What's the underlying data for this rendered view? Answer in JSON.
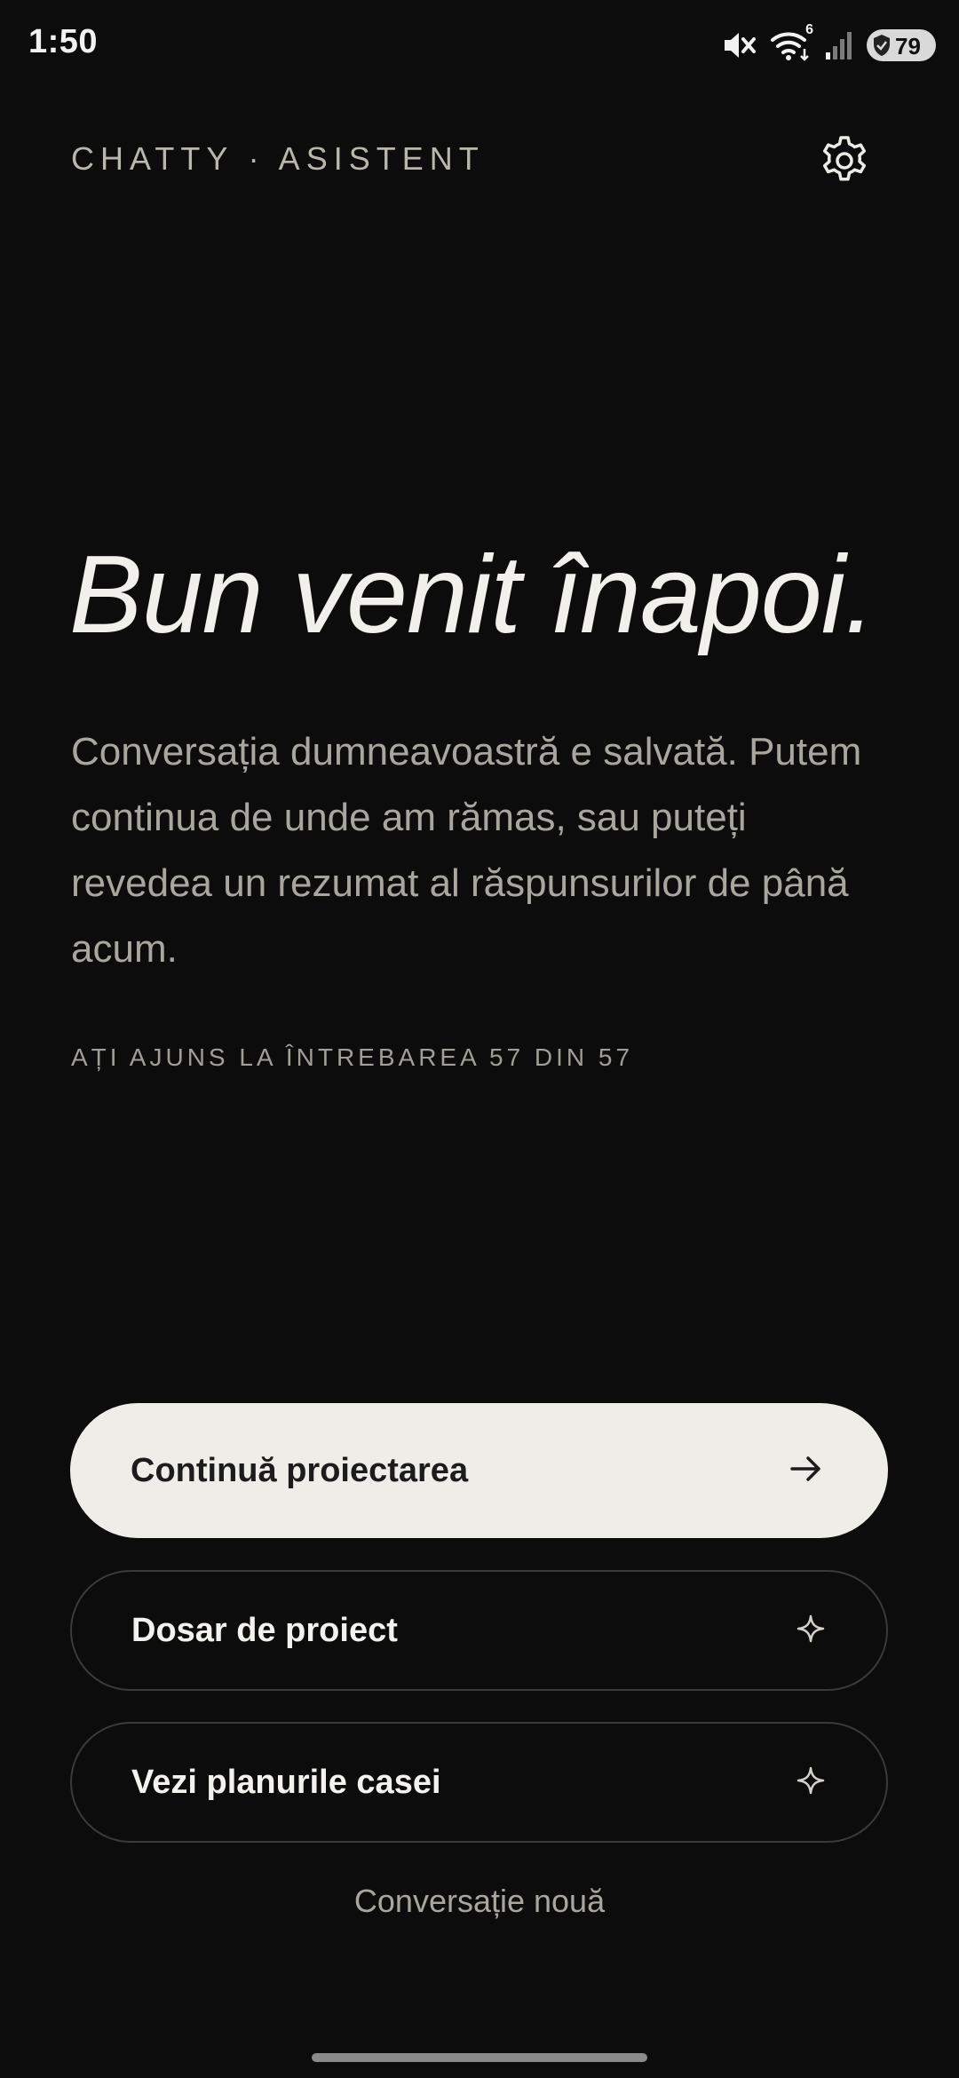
{
  "status_bar": {
    "time": "1:50",
    "battery_level": "79",
    "wifi_badge": "6",
    "icons": [
      "mute-icon",
      "wifi-icon",
      "signal-icon",
      "battery-icon"
    ]
  },
  "header": {
    "app_title": "CHATTY · ASISTENT",
    "settings_icon": "gear-icon"
  },
  "hero": {
    "title": "Bun venit înapoi.",
    "body": "Conversația dumneavoastră e salvată. Putem continua de unde am rămas, sau puteți revedea un rezumat al răspunsurilor de până acum.",
    "progress": "AȚI AJUNS LA ÎNTREBAREA 57 DIN 57"
  },
  "actions": {
    "continue_label": "Continuă proiectarea",
    "continue_icon": "arrow-right-icon",
    "dossier_label": "Dosar de proiect",
    "plans_label": "Vezi planurile casei",
    "secondary_icon": "sparkle-icon",
    "new_conversation_label": "Conversație nouă"
  },
  "colors": {
    "background": "#0c0c0c",
    "primary_button": "#eeede8",
    "text_primary": "#f1f0ec",
    "text_secondary": "#a9a69f"
  }
}
